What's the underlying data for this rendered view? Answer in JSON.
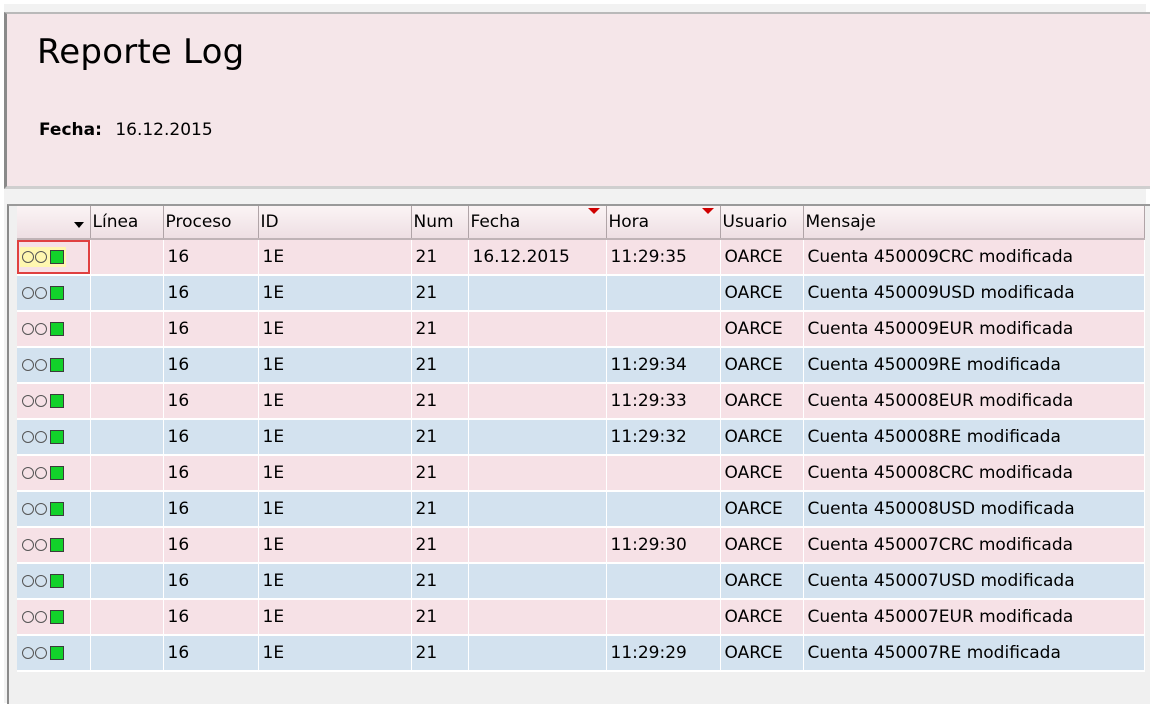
{
  "report": {
    "title": "Reporte Log",
    "date_label": "Fecha:",
    "date_value": "16.12.2015"
  },
  "table": {
    "columns": [
      "",
      "Línea",
      "Proceso",
      "ID",
      "Num",
      "Fecha",
      "Hora",
      "Usuario",
      "Mensaje"
    ],
    "rows": [
      {
        "linea": "",
        "proceso": "16",
        "id": "1E",
        "num": "21",
        "fecha": "16.12.2015",
        "hora": "11:29:35",
        "usuario": "OARCE",
        "mensaje": "Cuenta 450009CRC modificada",
        "status_icon": "traffic-light-green-icon"
      },
      {
        "linea": "",
        "proceso": "16",
        "id": "1E",
        "num": "21",
        "fecha": "",
        "hora": "",
        "usuario": "OARCE",
        "mensaje": "Cuenta 450009USD modificada",
        "status_icon": "traffic-light-green-icon"
      },
      {
        "linea": "",
        "proceso": "16",
        "id": "1E",
        "num": "21",
        "fecha": "",
        "hora": "",
        "usuario": "OARCE",
        "mensaje": "Cuenta 450009EUR modificada",
        "status_icon": "traffic-light-green-icon"
      },
      {
        "linea": "",
        "proceso": "16",
        "id": "1E",
        "num": "21",
        "fecha": "",
        "hora": "11:29:34",
        "usuario": "OARCE",
        "mensaje": "Cuenta 450009RE modificada",
        "status_icon": "traffic-light-green-icon"
      },
      {
        "linea": "",
        "proceso": "16",
        "id": "1E",
        "num": "21",
        "fecha": "",
        "hora": "11:29:33",
        "usuario": "OARCE",
        "mensaje": "Cuenta 450008EUR modificada",
        "status_icon": "traffic-light-green-icon"
      },
      {
        "linea": "",
        "proceso": "16",
        "id": "1E",
        "num": "21",
        "fecha": "",
        "hora": "11:29:32",
        "usuario": "OARCE",
        "mensaje": "Cuenta 450008RE modificada",
        "status_icon": "traffic-light-green-icon"
      },
      {
        "linea": "",
        "proceso": "16",
        "id": "1E",
        "num": "21",
        "fecha": "",
        "hora": "",
        "usuario": "OARCE",
        "mensaje": "Cuenta 450008CRC modificada",
        "status_icon": "traffic-light-green-icon"
      },
      {
        "linea": "",
        "proceso": "16",
        "id": "1E",
        "num": "21",
        "fecha": "",
        "hora": "",
        "usuario": "OARCE",
        "mensaje": "Cuenta 450008USD modificada",
        "status_icon": "traffic-light-green-icon"
      },
      {
        "linea": "",
        "proceso": "16",
        "id": "1E",
        "num": "21",
        "fecha": "",
        "hora": "11:29:30",
        "usuario": "OARCE",
        "mensaje": "Cuenta 450007CRC modificada",
        "status_icon": "traffic-light-green-icon"
      },
      {
        "linea": "",
        "proceso": "16",
        "id": "1E",
        "num": "21",
        "fecha": "",
        "hora": "",
        "usuario": "OARCE",
        "mensaje": "Cuenta 450007USD modificada",
        "status_icon": "traffic-light-green-icon"
      },
      {
        "linea": "",
        "proceso": "16",
        "id": "1E",
        "num": "21",
        "fecha": "",
        "hora": "",
        "usuario": "OARCE",
        "mensaje": "Cuenta 450007EUR modificada",
        "status_icon": "traffic-light-green-icon"
      },
      {
        "linea": "",
        "proceso": "16",
        "id": "1E",
        "num": "21",
        "fecha": "",
        "hora": "11:29:29",
        "usuario": "OARCE",
        "mensaje": "Cuenta 450007RE modificada",
        "status_icon": "traffic-light-green-icon"
      }
    ]
  },
  "colors": {
    "header_bg": "#f5e6e9",
    "row_pink": "#f6e1e6",
    "row_blue": "#d3e2ef",
    "status_green": "#12d12a",
    "sort_marker": "#d00000"
  }
}
